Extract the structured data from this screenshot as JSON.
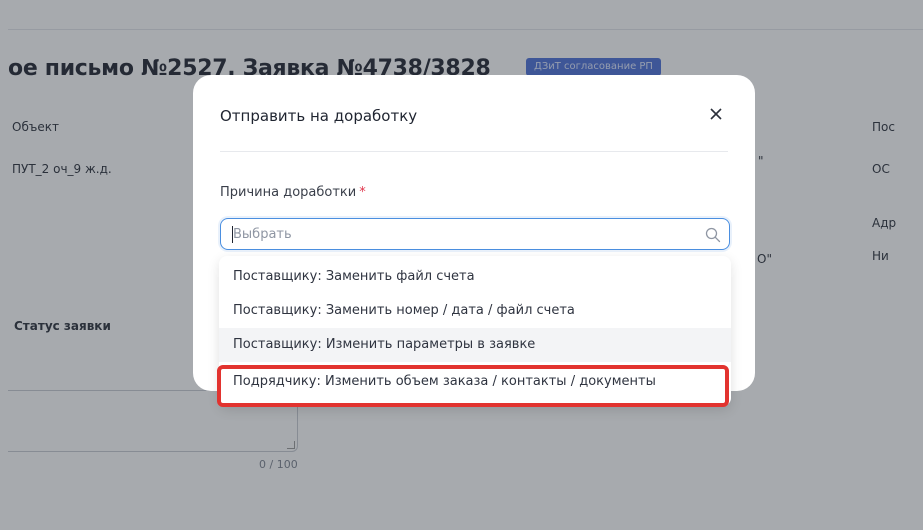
{
  "page": {
    "title": "ое письмо №2527. Заявка №4738/3828",
    "status_badge": "ДЗиТ согласование РП",
    "object_label": "Объект",
    "object_value": "ПУТ_2 оч_9 ж.д.",
    "status_label": "Статус заявки",
    "counter": "0 / 100",
    "col3_fragment_1": "\"",
    "col3_fragment_2": "О\"",
    "col4_label_1": "Пос",
    "col4_value_1": "ОС",
    "col4_label_2": "Адр",
    "col4_value_2": "Ни"
  },
  "modal": {
    "title": "Отправить на доработку",
    "field_label": "Причина доработки",
    "required_mark": "*",
    "select_placeholder": "Выбрать",
    "options": [
      {
        "label": "Поставщику: Заменить файл счета"
      },
      {
        "label": "Поставщику: Заменить номер / дата / файл счета"
      },
      {
        "label": "Поставщику: Изменить параметры в заявке"
      },
      {
        "label": "Подрядчику: Изменить объем заказа / контакты / документы"
      }
    ]
  },
  "colors": {
    "accent": "#4b8fe0",
    "highlight": "#e2332f",
    "required": "#e0334a",
    "badge": "#4a6fd8"
  }
}
